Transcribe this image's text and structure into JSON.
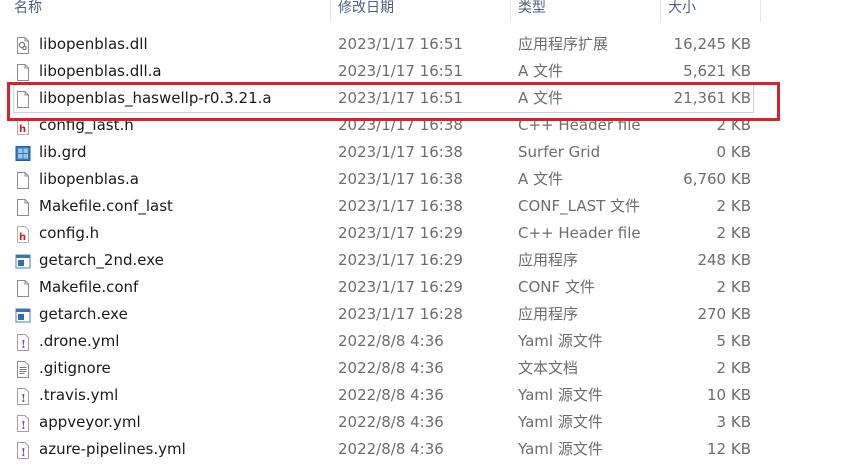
{
  "columns": {
    "name": "名称",
    "date": "修改日期",
    "type": "类型",
    "size": "大小"
  },
  "files": [
    {
      "name": "libopenblas.dll",
      "date": "2023/1/17 16:51",
      "type": "应用程序扩展",
      "size": "16,245 KB",
      "icon": "dll-icon"
    },
    {
      "name": "libopenblas.dll.a",
      "date": "2023/1/17 16:51",
      "type": "A 文件",
      "size": "5,621 KB",
      "icon": "blank-file-icon"
    },
    {
      "name": "libopenblas_haswellp-r0.3.21.a",
      "date": "2023/1/17 16:51",
      "type": "A 文件",
      "size": "21,361 KB",
      "icon": "blank-file-icon"
    },
    {
      "name": "config_last.h",
      "date": "2023/1/17 16:38",
      "type": "C++ Header file",
      "size": "2 KB",
      "icon": "header-file-icon"
    },
    {
      "name": "lib.grd",
      "date": "2023/1/17 16:38",
      "type": "Surfer Grid",
      "size": "0 KB",
      "icon": "grid-file-icon"
    },
    {
      "name": "libopenblas.a",
      "date": "2023/1/17 16:38",
      "type": "A 文件",
      "size": "6,760 KB",
      "icon": "blank-file-icon"
    },
    {
      "name": "Makefile.conf_last",
      "date": "2023/1/17 16:38",
      "type": "CONF_LAST 文件",
      "size": "2 KB",
      "icon": "blank-file-icon"
    },
    {
      "name": "config.h",
      "date": "2023/1/17 16:29",
      "type": "C++ Header file",
      "size": "2 KB",
      "icon": "header-file-icon"
    },
    {
      "name": "getarch_2nd.exe",
      "date": "2023/1/17 16:29",
      "type": "应用程序",
      "size": "248 KB",
      "icon": "exe-icon"
    },
    {
      "name": "Makefile.conf",
      "date": "2023/1/17 16:29",
      "type": "CONF 文件",
      "size": "2 KB",
      "icon": "blank-file-icon"
    },
    {
      "name": "getarch.exe",
      "date": "2023/1/17 16:28",
      "type": "应用程序",
      "size": "270 KB",
      "icon": "exe-icon"
    },
    {
      "name": ".drone.yml",
      "date": "2022/8/8 4:36",
      "type": "Yaml 源文件",
      "size": "5 KB",
      "icon": "yaml-file-icon"
    },
    {
      "name": ".gitignore",
      "date": "2022/8/8 4:36",
      "type": "文本文档",
      "size": "2 KB",
      "icon": "text-file-icon"
    },
    {
      "name": ".travis.yml",
      "date": "2022/8/8 4:36",
      "type": "Yaml 源文件",
      "size": "10 KB",
      "icon": "yaml-file-icon"
    },
    {
      "name": "appveyor.yml",
      "date": "2022/8/8 4:36",
      "type": "Yaml 源文件",
      "size": "3 KB",
      "icon": "yaml-file-icon"
    },
    {
      "name": "azure-pipelines.yml",
      "date": "2022/8/8 4:36",
      "type": "Yaml 源文件",
      "size": "12 KB",
      "icon": "yaml-file-icon"
    }
  ],
  "highlighted_index": 2,
  "colors": {
    "annotation_frame": "#d42430",
    "header_text": "#4d6082",
    "secondary_text": "#6d6d6d"
  }
}
